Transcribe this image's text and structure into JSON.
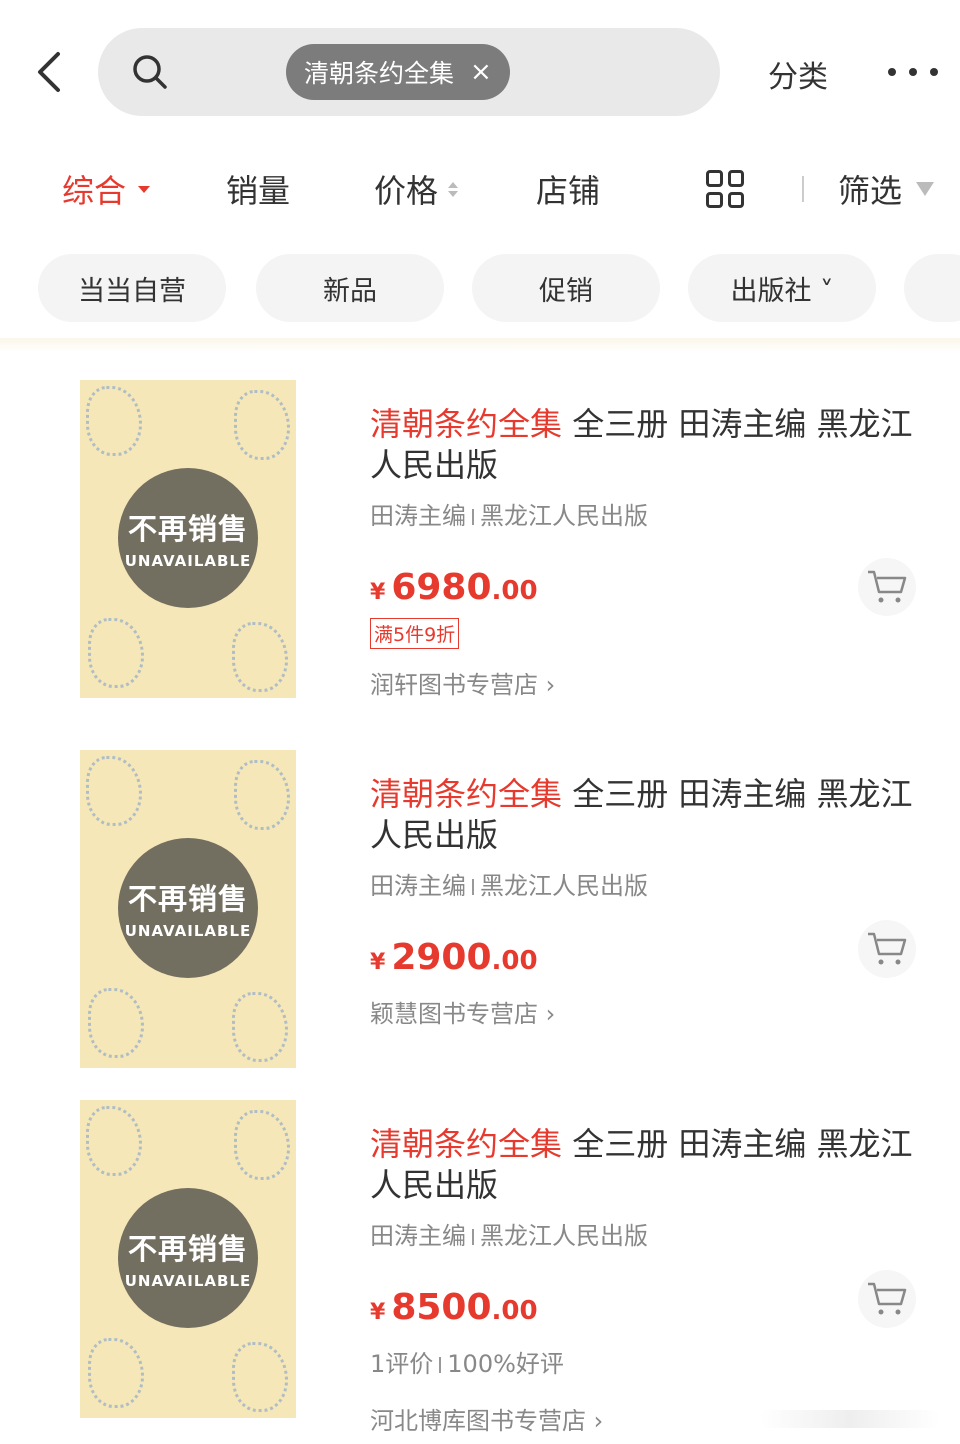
{
  "header": {
    "search_chip": "清朝条约全集",
    "chip_close": "×",
    "category_label": "分类"
  },
  "sort_tabs": [
    {
      "label": "综合",
      "active": true
    },
    {
      "label": "销量"
    },
    {
      "label": "价格"
    },
    {
      "label": "店铺"
    },
    {
      "label": "筛选"
    }
  ],
  "filter_tags": [
    "当当自营",
    "新品",
    "促销",
    "出版社 ˅"
  ],
  "products": [
    {
      "title_highlight": "清朝条约全集",
      "title_rest": " 全三册 田涛主编 黑龙江人民出版",
      "author": "田涛主编",
      "publisher": "黑龙江人民出版",
      "cover_badge_cn": "不再销售",
      "cover_badge_en": "UNAVAILABLE",
      "currency": "¥",
      "price_int": "6980",
      "price_dec": ".00",
      "promo": "满5件9折",
      "shop": "润轩图书专营店 ›"
    },
    {
      "title_highlight": "清朝条约全集",
      "title_rest": " 全三册 田涛主编 黑龙江人民出版",
      "author": "田涛主编",
      "publisher": "黑龙江人民出版",
      "cover_badge_cn": "不再销售",
      "cover_badge_en": "UNAVAILABLE",
      "currency": "¥",
      "price_int": "2900",
      "price_dec": ".00",
      "shop": "颖慧图书专营店 ›"
    },
    {
      "title_highlight": "清朝条约全集",
      "title_rest": " 全三册 田涛主编 黑龙江人民出版",
      "author": "田涛主编",
      "publisher": "黑龙江人民出版",
      "cover_badge_cn": "不再销售",
      "cover_badge_en": "UNAVAILABLE",
      "currency": "¥",
      "price_int": "8500",
      "price_dec": ".00",
      "review_count": "1评价",
      "good_rate": "100%好评",
      "shop": "河北博库图书专营店 ›"
    }
  ],
  "colors": {
    "accent": "#e63a2e",
    "cover": "#f5e7b8",
    "badge": "#5a5850"
  },
  "icons": [
    "back-arrow-icon",
    "search-icon",
    "more-icon",
    "sort-caret-icon",
    "price-sort-icon",
    "grid-view-icon",
    "filter-funnel-icon",
    "cart-icon"
  ]
}
